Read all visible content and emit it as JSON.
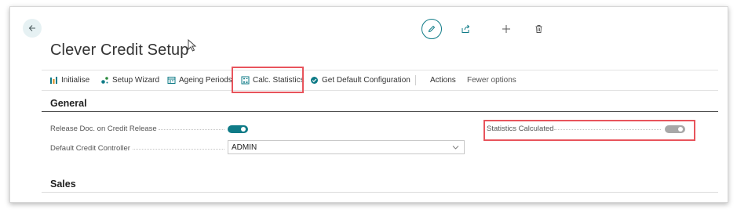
{
  "page": {
    "title": "Clever Credit Setup"
  },
  "actionbar": {
    "items": [
      {
        "label": "Initialise",
        "icon": "initialise-icon"
      },
      {
        "label": "Setup Wizard",
        "icon": "setup-wizard-icon"
      },
      {
        "label": "Ageing Periods",
        "icon": "ageing-periods-icon"
      },
      {
        "label": "Calc. Statistics",
        "icon": "calc-statistics-icon"
      },
      {
        "label": "Get Default Configuration",
        "icon": "check-circle-icon"
      }
    ],
    "actions_label": "Actions",
    "fewer_options_label": "Fewer options"
  },
  "sections": {
    "general": {
      "title": "General",
      "fields": {
        "release_doc": {
          "label": "Release Doc. on Credit Release",
          "value": true
        },
        "default_credit_controller": {
          "label": "Default Credit Controller",
          "value": "ADMIN"
        },
        "statistics_calculated": {
          "label": "Statistics Calculated",
          "value": true
        }
      }
    },
    "sales": {
      "title": "Sales"
    }
  },
  "colors": {
    "accent": "#0f7b87",
    "toggle_on": "#0f7b87",
    "toggle_disabled": "#a8a8a8",
    "highlight": "#e8545c"
  }
}
